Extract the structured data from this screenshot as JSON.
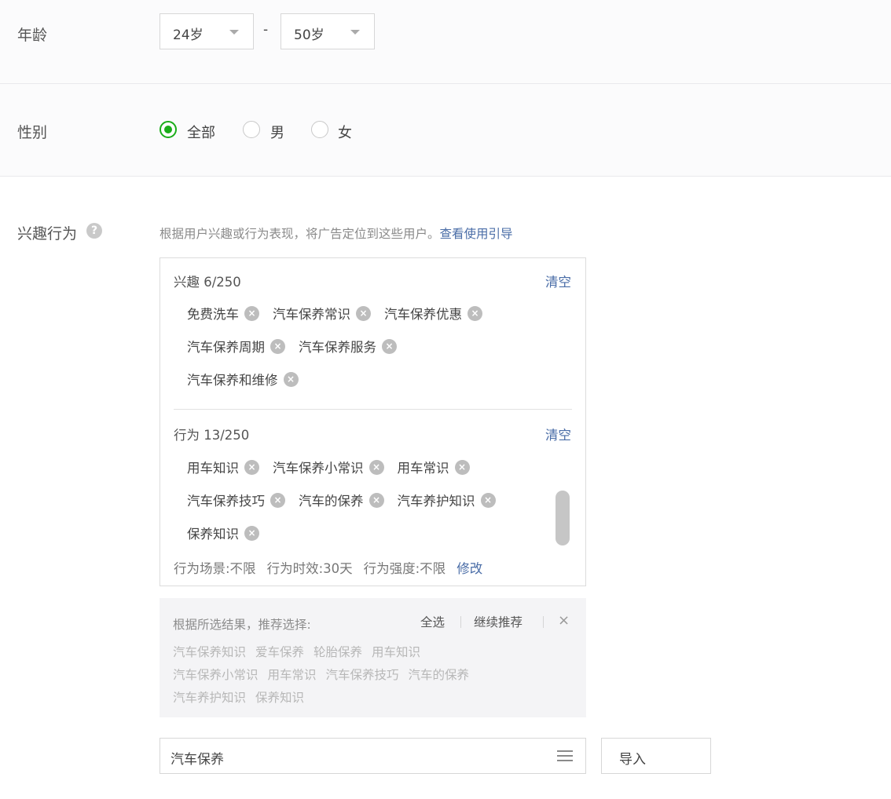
{
  "age": {
    "label": "年龄",
    "min": "24岁",
    "max": "50岁",
    "dash": "-"
  },
  "gender": {
    "label": "性别",
    "options": [
      "全部",
      "男",
      "女"
    ],
    "selected": "全部"
  },
  "interest_behavior": {
    "label": "兴趣行为",
    "hint": "根据用户兴趣或行为表现，将广告定位到这些用户。",
    "guide_link": "查看使用引导",
    "interests": {
      "title": "兴趣 6/250",
      "clear": "清空",
      "tags": [
        "免费洗车",
        "汽车保养常识",
        "汽车保养优惠",
        "汽车保养周期",
        "汽车保养服务",
        "汽车保养和维修"
      ]
    },
    "behaviors": {
      "title": "行为 13/250",
      "clear": "清空",
      "tags": [
        "用车知识",
        "汽车保养小常识",
        "用车常识",
        "汽车保养技巧",
        "汽车的保养",
        "汽车养护知识",
        "保养知识"
      ],
      "scene": "行为场景:不限",
      "timeliness": "行为时效:30天",
      "intensity": "行为强度:不限",
      "modify": "修改"
    }
  },
  "recommend": {
    "title": "根据所选结果，推荐选择:",
    "select_all": "全选",
    "continue": "继续推荐",
    "close": "×",
    "rows": [
      [
        "汽车保养知识",
        "爱车保养",
        "轮胎保养",
        "用车知识"
      ],
      [
        "汽车保养小常识",
        "用车常识",
        "汽车保养技巧",
        "汽车的保养"
      ],
      [
        "汽车养护知识",
        "保养知识"
      ]
    ]
  },
  "search": {
    "value": "汽车保养"
  },
  "import_button": "导入"
}
